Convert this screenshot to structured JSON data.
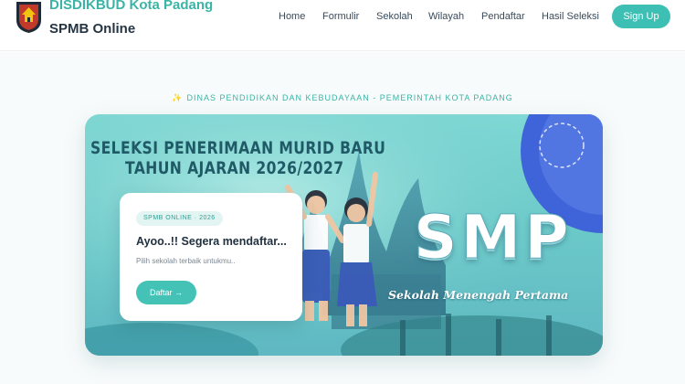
{
  "header": {
    "brand_line1": "DISDIKBUD Kota Padang",
    "brand_line2": "SPMB Online",
    "logo_icon": "padang-crest-icon",
    "nav": [
      "Home",
      "Formulir",
      "Sekolah",
      "Wilayah",
      "Pendaftar",
      "Hasil Seleksi"
    ],
    "signup_label": "Sign Up"
  },
  "hero": {
    "eyebrow_icon": "sparkle-icon",
    "eyebrow": "DINAS PENDIDIKAN DAN KEBUDAYAAN - PEMERINTAH KOTA PADANG"
  },
  "banner": {
    "title_line1": "SELEKSI PENERIMAAN MURID BARU",
    "title_line2": "TAHUN AJARAN 2026/2027",
    "level": "SMP",
    "level_full": "Sekolah Menengah Pertama"
  },
  "card": {
    "badge": "SPMB ONLINE · 2026",
    "title": "Ayoo..!! Segera mendaftar...",
    "description": "Pilih sekolah terbaik untukmu..",
    "button_label": "Daftar →"
  },
  "colors": {
    "accent": "#3dbfb3",
    "brand": "#3bb4a6",
    "text_dark": "#263544"
  }
}
